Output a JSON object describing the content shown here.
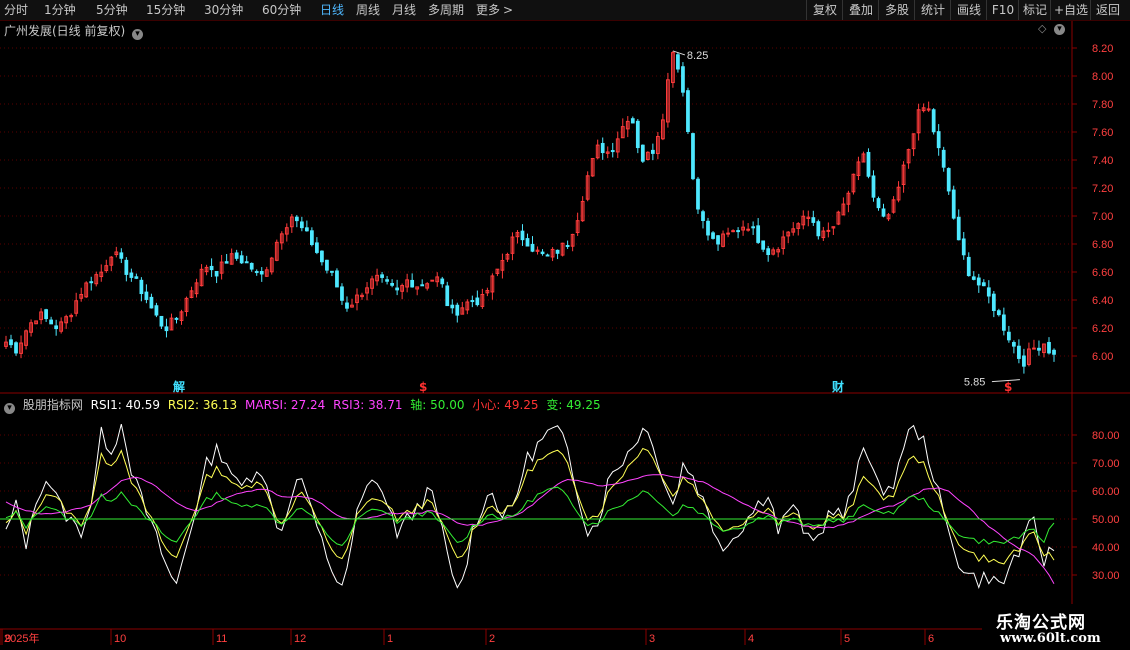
{
  "toolbar": {
    "periods": [
      "分时",
      "1分钟",
      "5分钟",
      "15分钟",
      "30分钟",
      "60分钟",
      "日线",
      "周线",
      "月线",
      "多周期",
      "更多"
    ],
    "active_period": "日线",
    "more_arrow": ">",
    "right_buttons": [
      "复权",
      "叠加",
      "多股",
      "统计",
      "画线",
      "F10",
      "标记",
      "+自选",
      "返回"
    ]
  },
  "main": {
    "title": "广州发展(日线 前复权)",
    "price_ticks": [
      "8.20",
      "8.00",
      "7.80",
      "7.60",
      "7.40",
      "7.20",
      "7.00",
      "6.80",
      "6.60",
      "6.40",
      "6.20",
      "6.00"
    ],
    "high_label": "8.25",
    "low_label": "5.85",
    "markers": [
      {
        "text": "解",
        "color": "#40e0ff"
      },
      {
        "text": "$",
        "color": "#ff3030"
      },
      {
        "text": "财",
        "color": "#40e0ff"
      },
      {
        "text": "$",
        "color": "#ff3030"
      }
    ],
    "colors": {
      "up": "#ff3b3b",
      "down": "#4ee8ff",
      "grid": "#5a0000"
    }
  },
  "indicator": {
    "name": "股朋指标网",
    "values": [
      {
        "label": "RSI1: 40.59",
        "color": "#ffffff"
      },
      {
        "label": "RSI2: 36.13",
        "color": "#ffff55"
      },
      {
        "label": "MARSI: 27.24",
        "color": "#ff44ff"
      },
      {
        "label": "RSI3: 38.71",
        "color": "#ff44ff"
      },
      {
        "label": "轴: 50.00",
        "color": "#33ee33"
      },
      {
        "label": "小心: 49.25",
        "color": "#ff3333"
      },
      {
        "label": "变: 49.25",
        "color": "#33ee33"
      }
    ],
    "ticks": [
      "80.00",
      "70.00",
      "60.00",
      "50.00",
      "40.00",
      "30.00"
    ]
  },
  "time_axis": [
    "2025年",
    "9",
    "10",
    "11",
    "12",
    "1",
    "2",
    "3",
    "4",
    "5",
    "6"
  ],
  "watermark": {
    "line1": "乐淘公式网",
    "line2": "www.60lt.com"
  },
  "chart_data": {
    "type": "candlestick",
    "y_range": [
      5.85,
      8.25
    ],
    "high": 8.25,
    "low": 5.85,
    "close_path": [
      6.1,
      6.05,
      6.2,
      6.3,
      6.25,
      6.2,
      6.3,
      6.45,
      6.55,
      6.6,
      6.75,
      6.65,
      6.55,
      6.45,
      6.3,
      6.2,
      6.25,
      6.4,
      6.55,
      6.65,
      6.6,
      6.7,
      6.7,
      6.65,
      6.55,
      6.7,
      6.9,
      7.0,
      6.9,
      6.8,
      6.65,
      6.55,
      6.35,
      6.4,
      6.5,
      6.55,
      6.5,
      6.45,
      6.55,
      6.5,
      6.55,
      6.55,
      6.3,
      6.35,
      6.4,
      6.4,
      6.55,
      6.7,
      6.85,
      6.85,
      6.75,
      6.7,
      6.75,
      6.8,
      7.0,
      7.3,
      7.5,
      7.45,
      7.6,
      7.75,
      7.4,
      7.45,
      7.7,
      8.2,
      7.9,
      7.2,
      6.9,
      6.8,
      6.85,
      6.9,
      6.95,
      6.85,
      6.75,
      6.8,
      6.9,
      6.95,
      7.0,
      6.85,
      6.9,
      7.05,
      7.25,
      7.45,
      7.1,
      6.95,
      7.1,
      7.4,
      7.7,
      7.8,
      7.5,
      7.2,
      6.8,
      6.6,
      6.5,
      6.4,
      6.25,
      6.1,
      5.95,
      6.05,
      6.1,
      6.0
    ],
    "indicator_range": [
      20,
      90
    ],
    "rsi1_path": [
      45,
      55,
      40,
      60,
      65,
      55,
      50,
      45,
      55,
      80,
      75,
      85,
      65,
      55,
      45,
      35,
      25,
      40,
      55,
      70,
      75,
      70,
      60,
      65,
      70,
      55,
      45,
      60,
      65,
      50,
      40,
      30,
      25,
      50,
      60,
      65,
      55,
      45,
      50,
      55,
      60,
      50,
      30,
      25,
      45,
      55,
      60,
      50,
      55,
      70,
      75,
      80,
      82,
      75,
      60,
      45,
      50,
      65,
      70,
      75,
      82,
      80,
      65,
      55,
      70,
      65,
      55,
      45,
      40,
      45,
      50,
      55,
      60,
      45,
      55,
      50,
      40,
      45,
      55,
      50,
      60,
      75,
      70,
      55,
      65,
      80,
      82,
      75,
      60,
      45,
      35,
      30,
      28,
      30,
      25,
      35,
      40,
      50,
      35,
      40
    ],
    "rsi2_path": [
      48,
      52,
      45,
      55,
      60,
      56,
      52,
      48,
      55,
      72,
      70,
      75,
      62,
      55,
      48,
      40,
      35,
      45,
      55,
      65,
      68,
      65,
      60,
      62,
      65,
      55,
      48,
      55,
      60,
      52,
      45,
      38,
      35,
      50,
      55,
      58,
      55,
      50,
      52,
      55,
      56,
      50,
      40,
      35,
      45,
      52,
      55,
      52,
      55,
      65,
      70,
      72,
      74,
      70,
      60,
      50,
      52,
      60,
      65,
      70,
      75,
      74,
      65,
      58,
      65,
      62,
      55,
      50,
      46,
      48,
      50,
      52,
      55,
      48,
      52,
      50,
      45,
      48,
      52,
      50,
      55,
      65,
      63,
      55,
      60,
      70,
      72,
      68,
      58,
      48,
      42,
      38,
      36,
      36,
      33,
      38,
      40,
      45,
      38,
      36
    ],
    "marsi_path": [
      56,
      54,
      53,
      52,
      52,
      52,
      53,
      54,
      55,
      58,
      61,
      64,
      65,
      64,
      62,
      59,
      56,
      54,
      53,
      54,
      56,
      58,
      59,
      60,
      61,
      60,
      58,
      58,
      58,
      57,
      55,
      52,
      50,
      50,
      50,
      51,
      52,
      52,
      52,
      52,
      53,
      52,
      50,
      48,
      48,
      48,
      49,
      50,
      51,
      53,
      56,
      59,
      62,
      64,
      64,
      63,
      62,
      62,
      63,
      64,
      65,
      66,
      66,
      65,
      65,
      64,
      63,
      61,
      59,
      57,
      55,
      53,
      52,
      50,
      49,
      48,
      47,
      47,
      47,
      48,
      49,
      51,
      53,
      54,
      55,
      57,
      59,
      61,
      61,
      60,
      57,
      54,
      50,
      47,
      44,
      41,
      39,
      37,
      33,
      27
    ],
    "var_path": [
      50,
      52,
      47,
      53,
      55,
      52,
      50,
      48,
      51,
      58,
      57,
      60,
      55,
      51,
      48,
      44,
      41,
      47,
      52,
      57,
      59,
      57,
      54,
      55,
      56,
      52,
      48,
      52,
      54,
      50,
      46,
      42,
      40,
      49,
      52,
      54,
      52,
      49,
      50,
      52,
      52,
      49,
      44,
      41,
      47,
      50,
      52,
      50,
      51,
      55,
      58,
      60,
      61,
      58,
      53,
      48,
      49,
      53,
      55,
      57,
      60,
      59,
      55,
      51,
      55,
      54,
      51,
      48,
      46,
      47,
      48,
      50,
      52,
      48,
      50,
      49,
      47,
      48,
      50,
      49,
      51,
      55,
      54,
      51,
      53,
      57,
      58,
      56,
      52,
      48,
      45,
      43,
      42,
      42,
      41,
      43,
      44,
      46,
      42,
      49
    ]
  }
}
